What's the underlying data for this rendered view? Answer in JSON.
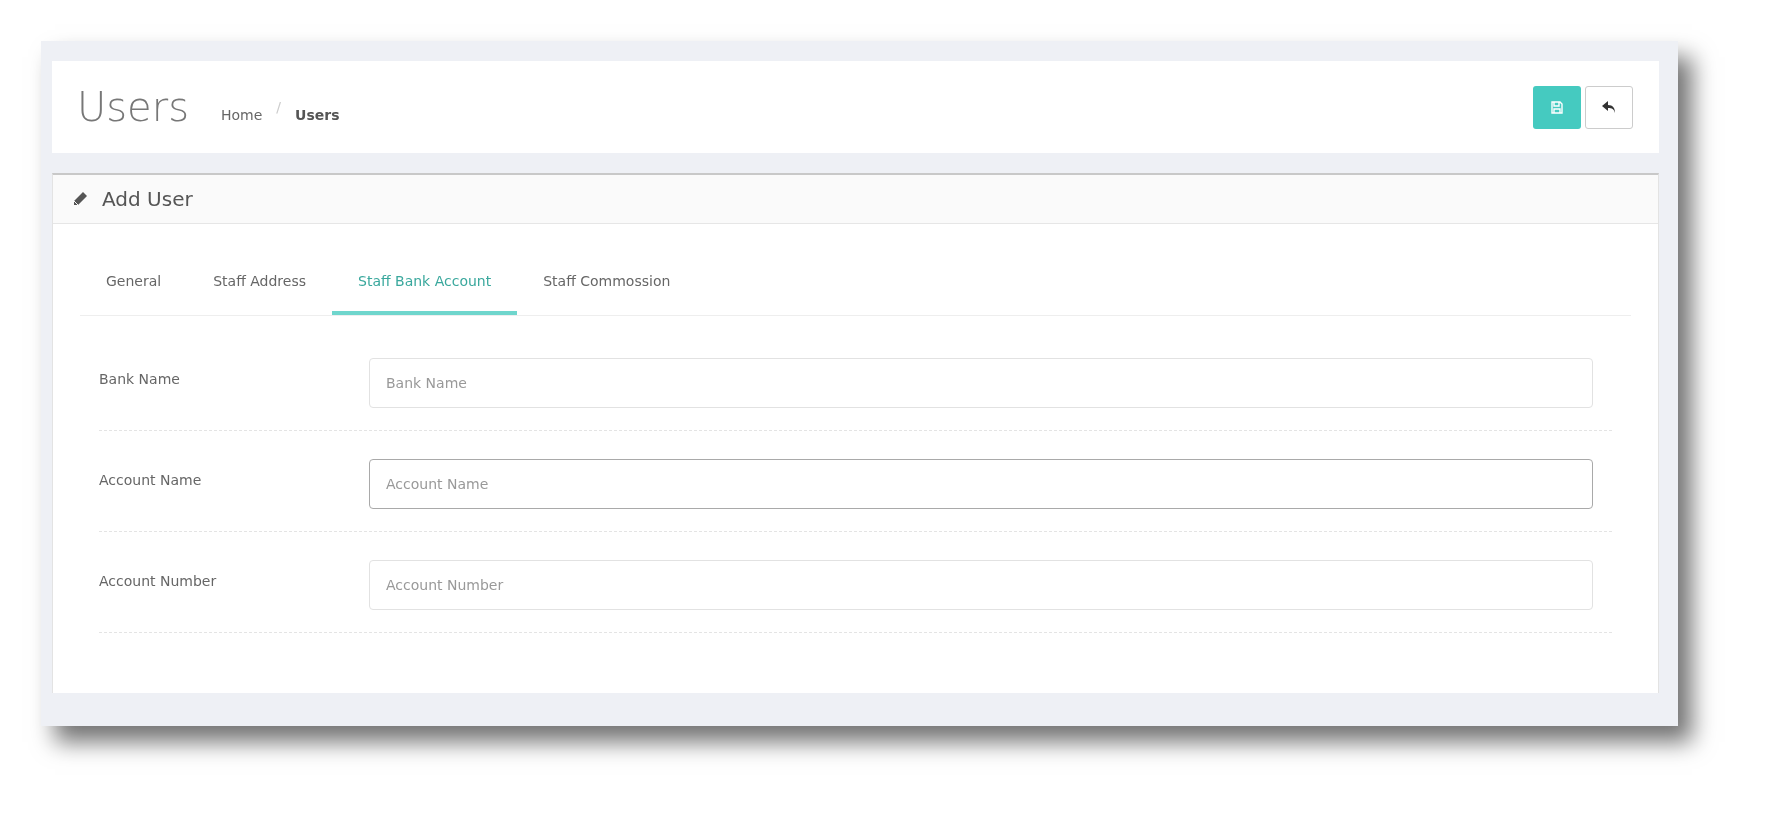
{
  "page": {
    "title": "Users",
    "breadcrumb_separator": "/",
    "breadcrumb": [
      {
        "label": "Home",
        "current": false
      },
      {
        "label": "Users",
        "current": true
      }
    ]
  },
  "toolbar": {
    "buttons": [
      {
        "kind": "save"
      },
      {
        "kind": "back"
      }
    ]
  },
  "card": {
    "title": "Add User",
    "tabs": [
      {
        "label": "General",
        "selected": false
      },
      {
        "label": "Staff Address",
        "selected": false
      },
      {
        "label": "Staff Bank Account",
        "selected": true
      },
      {
        "label": "Staff Commossion",
        "selected": false
      }
    ],
    "fields": [
      {
        "label": "Bank Name",
        "placeholder": "Bank Name",
        "focused": false
      },
      {
        "label": "Account Name",
        "placeholder": "Account Name",
        "focused": true
      },
      {
        "label": "Account Number",
        "placeholder": "Account Number",
        "focused": false
      }
    ]
  }
}
